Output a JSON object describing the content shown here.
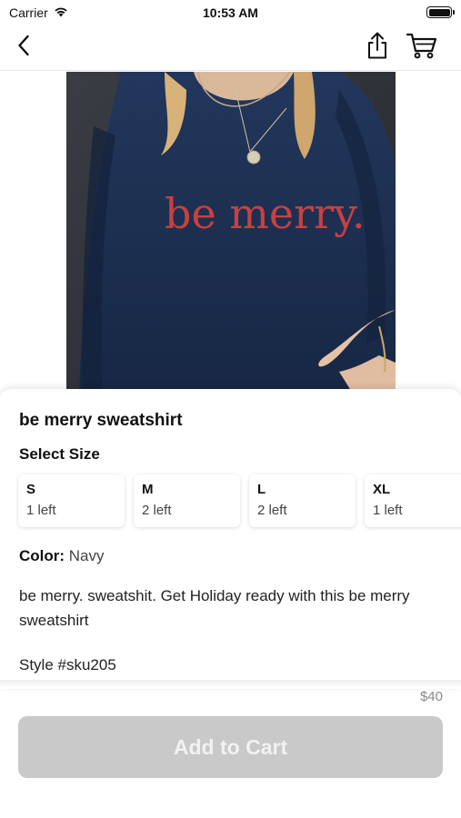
{
  "status_bar": {
    "carrier": "Carrier",
    "time": "10:53 AM"
  },
  "nav": {
    "back_icon": "chevron-left-icon",
    "share_icon": "share-icon",
    "cart_icon": "shopping-cart-icon"
  },
  "product": {
    "image_text": "be merry.",
    "title": "be merry sweatshirt",
    "size_heading": "Select Size",
    "sizes": [
      {
        "label": "S",
        "stock": "1 left"
      },
      {
        "label": "M",
        "stock": "2 left"
      },
      {
        "label": "L",
        "stock": "2 left"
      },
      {
        "label": "XL",
        "stock": "1 left"
      }
    ],
    "color_label": "Color:",
    "color_value": "Navy",
    "description": "be merry. sweatshit. Get Holiday ready with this be merry sweatshirt",
    "style": "Style #sku205"
  },
  "footer": {
    "price": "$40",
    "add_to_cart_label": "Add to Cart"
  },
  "colors": {
    "button_disabled": "#c9c9c9",
    "sweatshirt_navy": "#1c2e4f",
    "print_red": "#c8413f"
  }
}
